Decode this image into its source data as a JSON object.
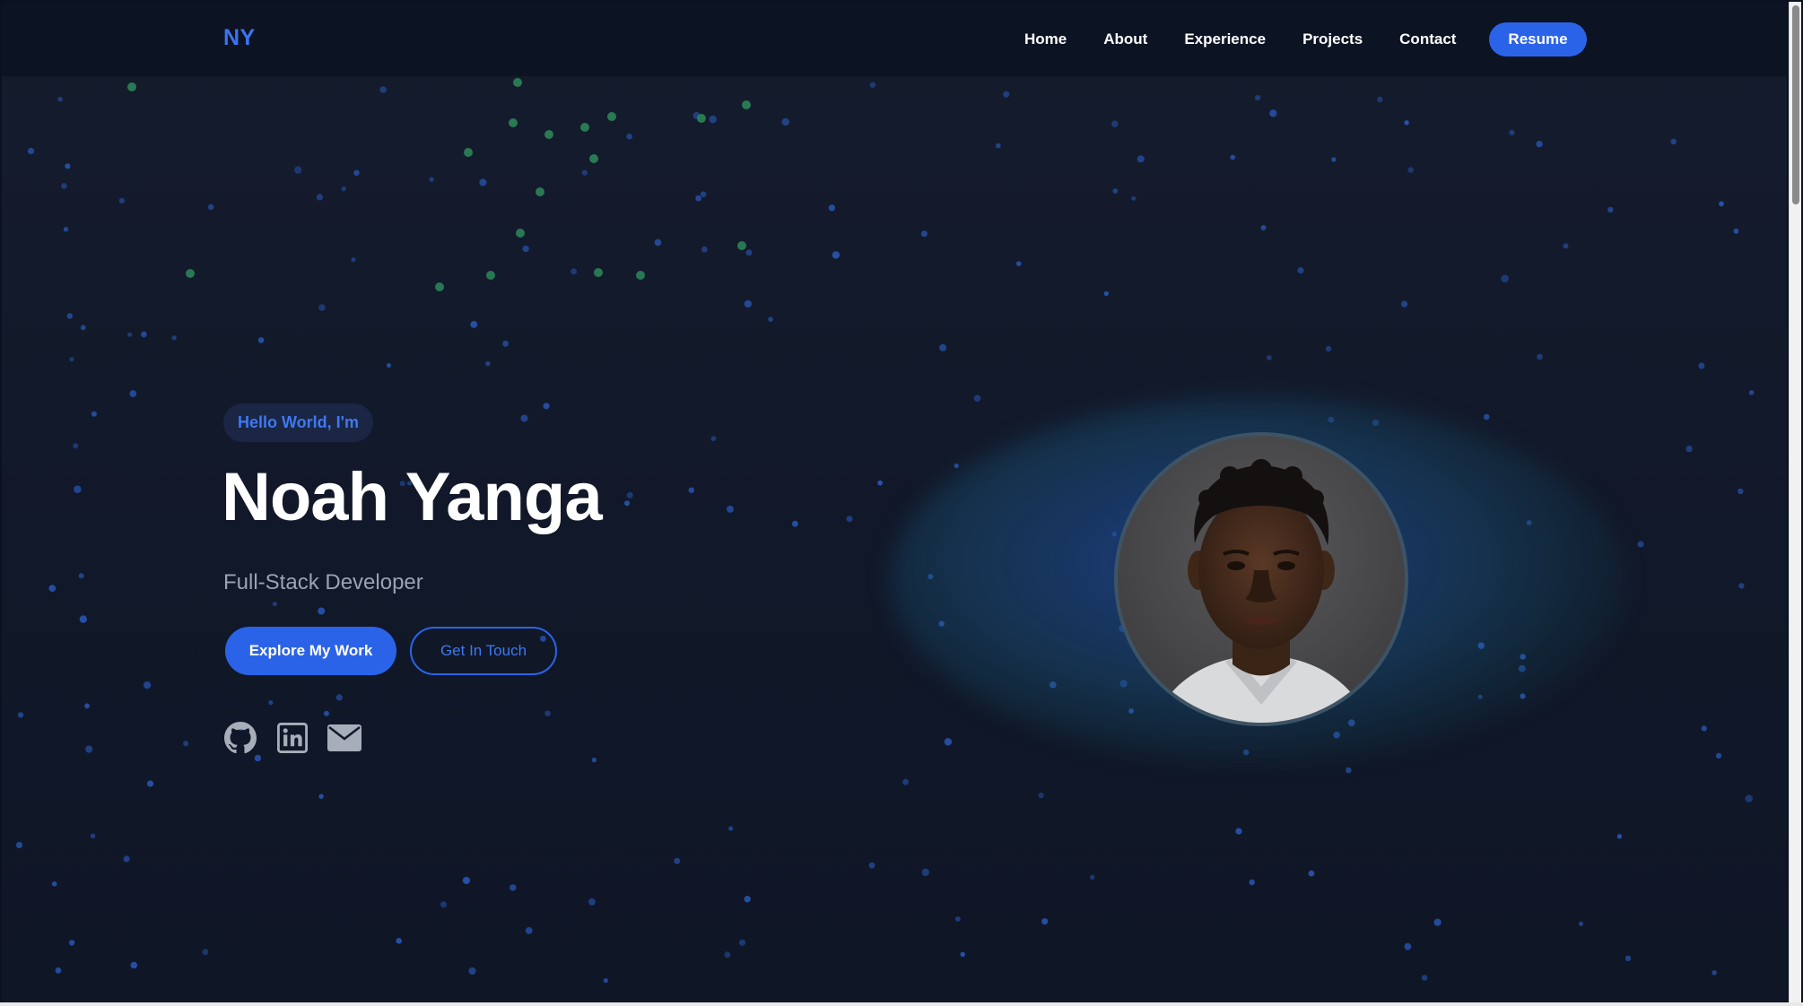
{
  "nav": {
    "logo": "NY",
    "links": [
      "Home",
      "About",
      "Experience",
      "Projects",
      "Contact"
    ],
    "resume_label": "Resume"
  },
  "hero": {
    "greeting": "Hello World, I'm",
    "name": "Noah Yanga",
    "role": "Full-Stack Developer",
    "primary_button": "Explore My Work",
    "secondary_button": "Get In Touch",
    "social_icons": [
      "github-icon",
      "linkedin-icon",
      "email-icon"
    ],
    "profile_photo": "profile-photo"
  },
  "colors": {
    "accent": "#2b63e8",
    "accent_text": "#3f78f0",
    "background": "#111829",
    "particle_blue": "#2a5bbf",
    "particle_green": "#2d8a5a",
    "muted_text": "#9aa3b2"
  }
}
